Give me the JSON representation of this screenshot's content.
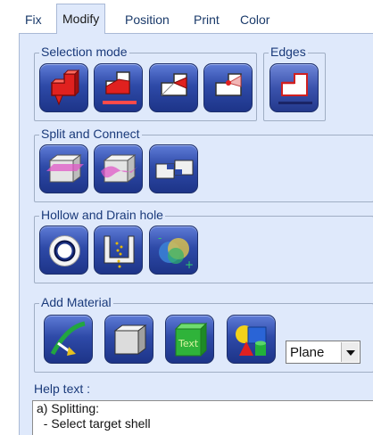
{
  "tabs": [
    {
      "label": "Fix",
      "active": false
    },
    {
      "label": "Modify",
      "active": true
    },
    {
      "label": "Position",
      "active": false
    },
    {
      "label": "Print",
      "active": false
    },
    {
      "label": "Color",
      "active": false
    }
  ],
  "groups": {
    "selection_mode": {
      "label": "Selection mode",
      "buttons": [
        "select-shell-icon",
        "select-surface-icon",
        "select-triangle-icon",
        "select-point-icon"
      ]
    },
    "edges": {
      "label": "Edges",
      "buttons": [
        "select-edge-icon"
      ]
    },
    "split_connect": {
      "label": "Split and Connect",
      "buttons": [
        "split-plane-icon",
        "split-curve-icon",
        "connect-icon"
      ]
    },
    "hollow_drain": {
      "label": "Hollow and Drain hole",
      "buttons": [
        "hollow-icon",
        "drain-hole-icon",
        "boolean-icon"
      ]
    },
    "add_material": {
      "label": "Add Material",
      "buttons": [
        "add-arc-icon",
        "add-box-icon",
        "add-text-icon",
        "add-primitives-icon"
      ]
    }
  },
  "plane_select": {
    "value": "Plane"
  },
  "help": {
    "label": "Help text :",
    "lines": [
      "a) Splitting:",
      "  - Select target shell"
    ]
  },
  "colors": {
    "panel_bg": "#dfe9fb",
    "button_blue": "#2e4aa8",
    "label_blue": "#1a3a7a"
  }
}
